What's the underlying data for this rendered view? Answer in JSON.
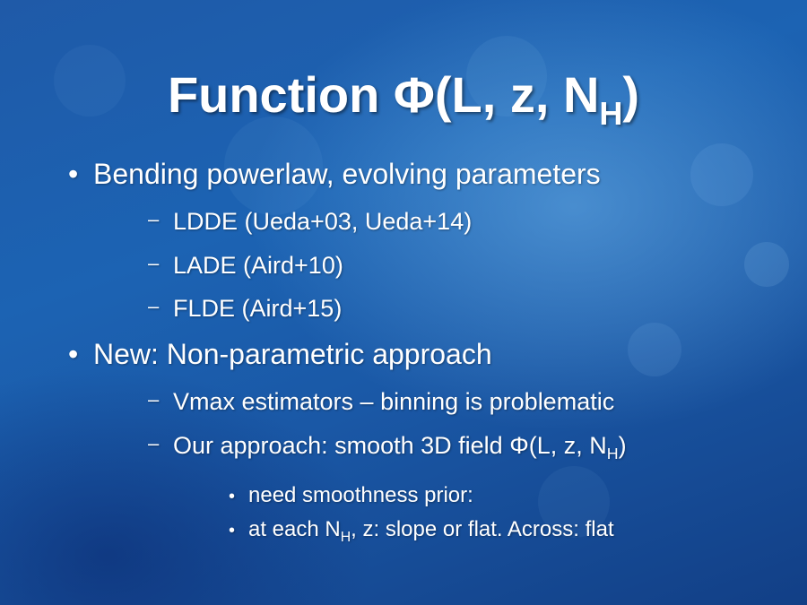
{
  "slide": {
    "title": {
      "main": "Function Φ(L, z, N",
      "sub": "H",
      "close": ")"
    },
    "bullets": [
      {
        "text": "Bending powerlaw, evolving parameters"
      },
      {
        "text": "LDDE (Ueda+03, Ueda+14)"
      },
      {
        "text": "LADE (Aird+10)"
      },
      {
        "text": "FLDE (Aird+15)"
      },
      {
        "text": "New: Non-parametric approach"
      },
      {
        "text": "Vmax estimators – binning is problematic"
      },
      {
        "text": "Our approach: smooth 3D field Φ(L, z, N",
        "sub": "H",
        "tail": ")"
      },
      {
        "text": "need smoothness prior:"
      },
      {
        "text": "at each N",
        "sub": "H",
        "tail": ", z: slope or flat. Across: flat"
      }
    ],
    "markers": {
      "level1": "•",
      "level2": "–",
      "level3": "•"
    }
  }
}
